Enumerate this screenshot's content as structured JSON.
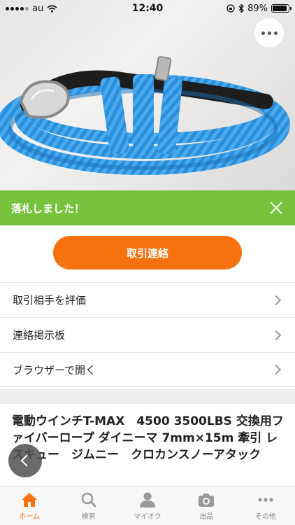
{
  "status_bar": {
    "carrier": "au",
    "time": "12:40",
    "battery": "89%",
    "battery_level": 0.89
  },
  "banner": {
    "text": "落札しました！"
  },
  "primary_button": {
    "label": "取引連絡"
  },
  "actions": [
    {
      "label": "取引相手を評価"
    },
    {
      "label": "連絡掲示板"
    },
    {
      "label": "ブラウザーで開く"
    }
  ],
  "item": {
    "title": "電動ウインチT-MAX　4500 3500LBS 交換用ファイバーロープ ダイニーマ 7mm×15m 牽引 レスキュー　ジムニー　クロカンスノーアタック"
  },
  "tabbar": {
    "tabs": [
      {
        "label": "ホーム",
        "icon": "home-icon",
        "active": true
      },
      {
        "label": "検索",
        "icon": "search-icon",
        "active": false
      },
      {
        "label": "マイオク",
        "icon": "person-icon",
        "active": false
      },
      {
        "label": "出品",
        "icon": "camera-icon",
        "active": false
      },
      {
        "label": "その他",
        "icon": "more-icon",
        "active": false
      }
    ]
  },
  "colors": {
    "accent": "#f6720f",
    "success": "#77c23d",
    "rope": "#2a8fd8"
  }
}
